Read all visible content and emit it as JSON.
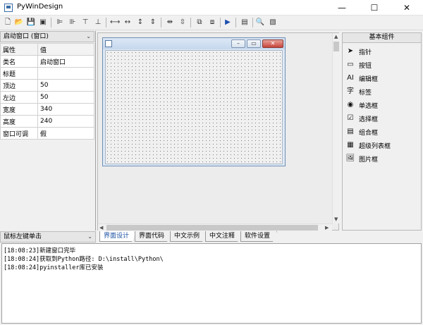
{
  "window": {
    "title": "PyWinDesign",
    "minimize": "—",
    "maximize": "☐",
    "close": "✕"
  },
  "toolbar": {
    "icons": [
      "new-icon",
      "open-icon",
      "save-icon",
      "save-all-icon",
      "align-left-icon",
      "align-center-icon",
      "align-top-icon",
      "align-bottom-icon",
      "same-width-icon",
      "hspace-icon",
      "vspace-icon",
      "same-height-icon",
      "center-h-icon",
      "center-v-icon",
      "bring-front-icon",
      "send-back-icon",
      "run-icon",
      "layout-icon",
      "find-icon",
      "preview-icon"
    ]
  },
  "left_panel": {
    "object_select": "启动窗口 (窗口)",
    "header": {
      "name": "属性",
      "value": "值"
    },
    "properties": [
      {
        "name": "类名",
        "value": "启动窗口"
      },
      {
        "name": "标题",
        "value": ""
      },
      {
        "name": "顶边",
        "value": "50"
      },
      {
        "name": "左边",
        "value": "50"
      },
      {
        "name": "宽度",
        "value": "340"
      },
      {
        "name": "高度",
        "value": "240"
      },
      {
        "name": "窗口可调",
        "value": "假"
      }
    ],
    "event_select": "鼠标左键单击"
  },
  "right_panel": {
    "title": "基本组件",
    "components": [
      {
        "label": "指针",
        "icon": "pointer-icon"
      },
      {
        "label": "按钮",
        "icon": "button-icon"
      },
      {
        "label": "编辑框",
        "icon": "textbox-icon"
      },
      {
        "label": "标签",
        "icon": "label-icon"
      },
      {
        "label": "单选框",
        "icon": "radio-icon"
      },
      {
        "label": "选择框",
        "icon": "checkbox-icon"
      },
      {
        "label": "组合框",
        "icon": "groupbox-icon"
      },
      {
        "label": "超级列表框",
        "icon": "listview-icon"
      },
      {
        "label": "图片框",
        "icon": "picturebox-icon"
      }
    ]
  },
  "tabs": [
    "界面设计",
    "界面代码",
    "中文示例",
    "中文注释",
    "软件设置"
  ],
  "log": [
    "[18:08:23]新建窗口完毕",
    "[18:08:24]获取到Python路径: D:\\install\\Python\\",
    "[18:08:24]pyinstaller库已安装"
  ]
}
